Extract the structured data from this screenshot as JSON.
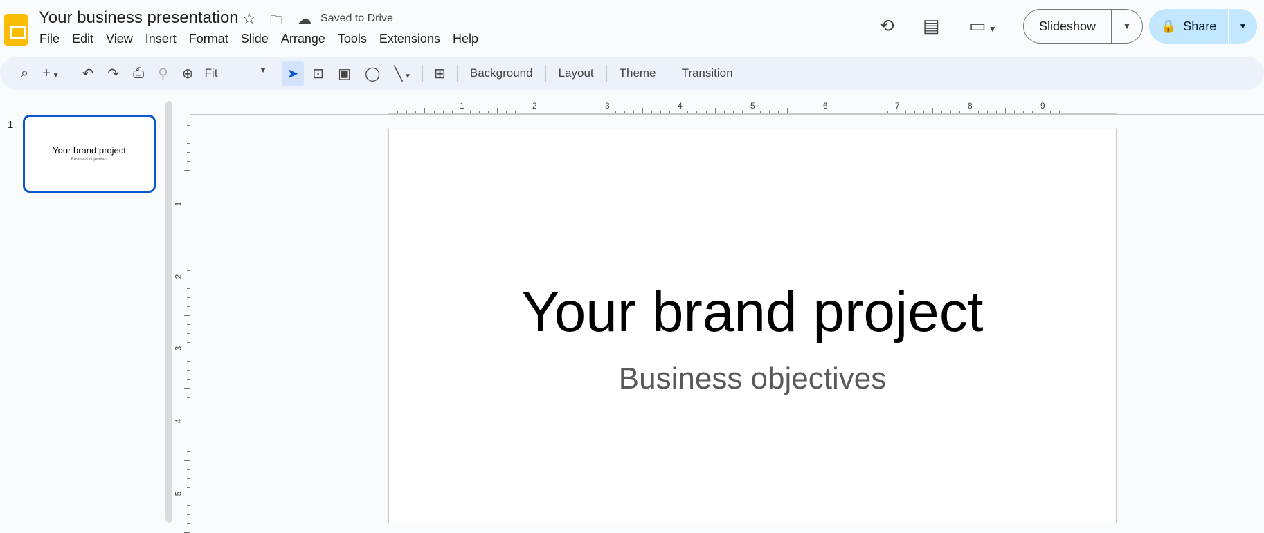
{
  "header": {
    "title": "Your business presentation",
    "saved_status": "Saved to Drive",
    "menu": [
      "File",
      "Edit",
      "View",
      "Insert",
      "Format",
      "Slide",
      "Arrange",
      "Tools",
      "Extensions",
      "Help"
    ],
    "slideshow_label": "Slideshow",
    "share_label": "Share"
  },
  "toolbar": {
    "zoom_value": "Fit",
    "background": "Background",
    "layout": "Layout",
    "theme": "Theme",
    "transition": "Transition"
  },
  "filmstrip": {
    "slides": [
      {
        "number": "1",
        "title": "Your brand project",
        "subtitle": "Business objectives"
      }
    ]
  },
  "slide": {
    "title": "Your brand project",
    "subtitle": "Business objectives"
  },
  "rulers": {
    "horizontal": [
      "1",
      "2",
      "3",
      "4",
      "5",
      "6",
      "7",
      "8",
      "9"
    ],
    "vertical": [
      "1",
      "2",
      "3",
      "4",
      "5"
    ]
  }
}
